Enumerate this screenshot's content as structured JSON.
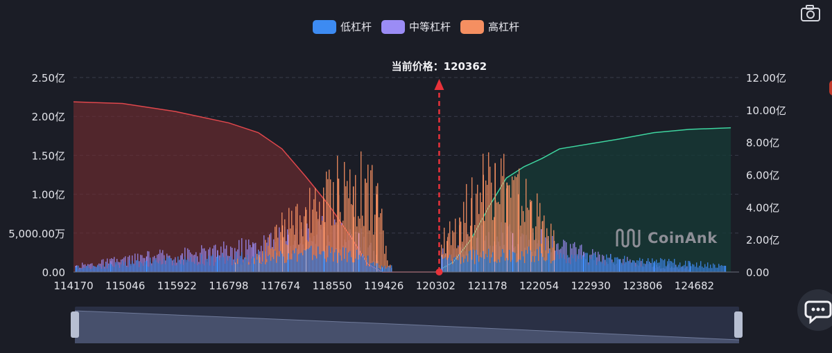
{
  "legend": [
    {
      "label": "低杠杆",
      "color": "#3d8bf2"
    },
    {
      "label": "中等杠杆",
      "color": "#9b8cf5"
    },
    {
      "label": "高杠杆",
      "color": "#f58f61"
    }
  ],
  "watermark": "CoinAnk",
  "icons": {
    "camera": "camera-icon",
    "chat": "chat-bubble-icon"
  },
  "colors": {
    "background": "#1b1d26",
    "short_cumulative": "#e0474c",
    "long_cumulative": "#3ed6a0",
    "current_price_marker": "#e8323a"
  },
  "chart_data": {
    "type": "bar",
    "current_price_label": "当前价格：120362",
    "current_price": 120362,
    "x_ticks": [
      "114170",
      "115046",
      "115922",
      "116798",
      "117674",
      "118550",
      "119426",
      "120302",
      "121178",
      "122054",
      "122930",
      "123806",
      "124682"
    ],
    "xlim": [
      114170,
      125440
    ],
    "left_axis": {
      "ticks": [
        "0.00",
        "5,000.00万",
        "1.00亿",
        "1.50亿",
        "2.00亿",
        "2.50亿"
      ],
      "ylim": [
        0,
        250000000
      ]
    },
    "right_axis": {
      "ticks": [
        "0.00",
        "2.00亿",
        "4.00亿",
        "6.00亿",
        "8.00亿",
        "10.00亿",
        "12.00亿"
      ],
      "ylim": [
        0,
        1200000000
      ]
    },
    "grid": true,
    "legend_position": "top-center",
    "series": [
      {
        "name": "低杠杆",
        "axis": "left",
        "x": [
          114200,
          114800,
          115400,
          116000,
          116600,
          117200,
          117800,
          118400,
          119000,
          119400,
          121000,
          121600,
          122200,
          122800,
          123400,
          124000,
          124600,
          125200
        ],
        "y": [
          6000000,
          10000000,
          14000000,
          16000000,
          18000000,
          20000000,
          24000000,
          26000000,
          22000000,
          6000000,
          22000000,
          26000000,
          24000000,
          20000000,
          16000000,
          14000000,
          12000000,
          8000000
        ]
      },
      {
        "name": "中等杠杆",
        "axis": "left",
        "x": [
          114200,
          114800,
          115400,
          116000,
          116600,
          117200,
          117800,
          118400,
          119000,
          119400,
          120400,
          121000,
          121600,
          122200,
          122800,
          123400,
          124000,
          124600
        ],
        "y": [
          8000000,
          14000000,
          20000000,
          24000000,
          28000000,
          36000000,
          48000000,
          58000000,
          50000000,
          6000000,
          22000000,
          44000000,
          50000000,
          40000000,
          26000000,
          16000000,
          10000000,
          6000000
        ]
      },
      {
        "name": "高杠杆",
        "axis": "left",
        "x": [
          116900,
          117300,
          117700,
          118100,
          118400,
          118650,
          118900,
          119100,
          119300,
          119500,
          120500,
          120700,
          120900,
          121100,
          121300,
          121500,
          121700,
          121900,
          122100,
          122300
        ],
        "y": [
          12000000,
          22000000,
          60000000,
          80000000,
          95000000,
          120000000,
          110000000,
          120000000,
          100000000,
          8000000,
          45000000,
          70000000,
          95000000,
          125000000,
          140000000,
          115000000,
          100000000,
          90000000,
          65000000,
          40000000
        ]
      },
      {
        "name": "short_cumulative",
        "axis": "right",
        "x": [
          114170,
          115000,
          115900,
          116800,
          117300,
          117700,
          118100,
          118500,
          118900,
          119150,
          119400,
          120302
        ],
        "y": [
          1050000000,
          1040000000,
          990000000,
          920000000,
          860000000,
          760000000,
          590000000,
          410000000,
          200000000,
          50000000,
          0,
          0
        ]
      },
      {
        "name": "long_cumulative",
        "axis": "right",
        "x": [
          120302,
          120600,
          120900,
          121200,
          121500,
          121800,
          122100,
          122400,
          122900,
          123400,
          124000,
          124600,
          125300
        ],
        "y": [
          0,
          60000000,
          200000000,
          400000000,
          580000000,
          650000000,
          700000000,
          760000000,
          790000000,
          820000000,
          860000000,
          880000000,
          890000000
        ]
      }
    ]
  }
}
